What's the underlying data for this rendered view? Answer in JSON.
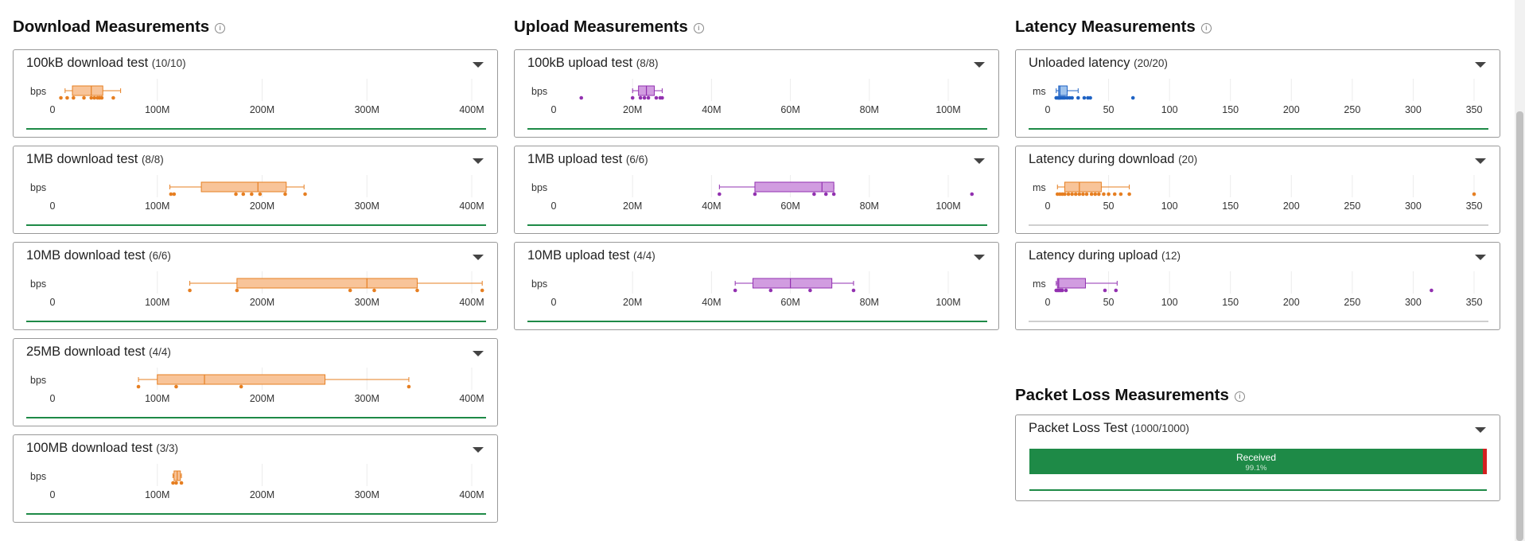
{
  "colors": {
    "download_fill": "#f8c499",
    "download_stroke": "#e67f22",
    "upload_fill": "#d19ce0",
    "upload_stroke": "#9231b0",
    "latency_unloaded_fill": "#9ec2ec",
    "latency_unloaded_stroke": "#1f63c4",
    "good_line": "#1e8a47",
    "neutral_line": "#cfcfcf",
    "packet_received": "#1e8a47",
    "packet_lost": "#d42020"
  },
  "sections": {
    "download": {
      "title": "Download Measurements",
      "info_icon": "info-icon",
      "cards": [
        {
          "title": "100kB download test",
          "count": "(10/10)",
          "unit": "bps",
          "axis_ticks": [
            "0",
            "100M",
            "200M",
            "300M",
            "400M"
          ],
          "box": {
            "min": 12000000,
            "q1": 19000000,
            "median": 37000000,
            "q3": 48000000,
            "max": 65000000
          },
          "points": [
            8000000,
            14000000,
            20000000,
            30000000,
            37000000,
            40000000,
            43000000,
            45000000,
            47000000,
            58000000
          ]
        },
        {
          "title": "1MB download test",
          "count": "(8/8)",
          "unit": "bps",
          "axis_ticks": [
            "0",
            "100M",
            "200M",
            "300M",
            "400M"
          ],
          "box": {
            "min": 112000000,
            "q1": 142000000,
            "median": 196000000,
            "q3": 223000000,
            "max": 240000000
          },
          "points": [
            113000000,
            116000000,
            175000000,
            182000000,
            190000000,
            198000000,
            222000000,
            241000000
          ]
        },
        {
          "title": "10MB download test",
          "count": "(6/6)",
          "unit": "bps",
          "axis_ticks": [
            "0",
            "100M",
            "200M",
            "300M",
            "400M"
          ],
          "box": {
            "min": 131000000,
            "q1": 176000000,
            "median": 300000000,
            "q3": 348000000,
            "max": 410000000
          },
          "points": [
            131000000,
            176000000,
            284000000,
            307000000,
            348000000,
            410000000
          ]
        },
        {
          "title": "25MB download test",
          "count": "(4/4)",
          "unit": "bps",
          "axis_ticks": [
            "0",
            "100M",
            "200M",
            "300M",
            "400M"
          ],
          "box": {
            "min": 82000000,
            "q1": 100000000,
            "median": 145000000,
            "q3": 260000000,
            "max": 340000000
          },
          "points": [
            82000000,
            118000000,
            180000000,
            340000000
          ]
        },
        {
          "title": "100MB download test",
          "count": "(3/3)",
          "unit": "bps",
          "axis_ticks": [
            "0",
            "100M",
            "200M",
            "300M",
            "400M"
          ],
          "box": {
            "min": 115000000,
            "q1": 116000000,
            "median": 119000000,
            "q3": 122000000,
            "max": 123000000
          },
          "points": [
            115000000,
            118000000,
            123000000
          ]
        }
      ]
    },
    "upload": {
      "title": "Upload Measurements",
      "info_icon": "info-icon",
      "cards": [
        {
          "title": "100kB upload test",
          "count": "(8/8)",
          "unit": "bps",
          "axis_ticks": [
            "0",
            "20M",
            "40M",
            "60M",
            "80M",
            "100M"
          ],
          "box": {
            "min": 20000000,
            "q1": 21500000,
            "median": 23500000,
            "q3": 25500000,
            "max": 27500000
          },
          "points": [
            7000000,
            20000000,
            22000000,
            23000000,
            24000000,
            26000000,
            27000000,
            27500000
          ]
        },
        {
          "title": "1MB upload test",
          "count": "(6/6)",
          "unit": "bps",
          "axis_ticks": [
            "0",
            "20M",
            "40M",
            "60M",
            "80M",
            "100M"
          ],
          "box": {
            "min": 42000000,
            "q1": 51000000,
            "median": 68000000,
            "q3": 71000000,
            "max": 71000000
          },
          "points": [
            42000000,
            51000000,
            66000000,
            69000000,
            71000000,
            106000000
          ]
        },
        {
          "title": "10MB upload test",
          "count": "(4/4)",
          "unit": "bps",
          "axis_ticks": [
            "0",
            "20M",
            "40M",
            "60M",
            "80M",
            "100M"
          ],
          "box": {
            "min": 46000000,
            "q1": 50500000,
            "median": 60000000,
            "q3": 70500000,
            "max": 76000000
          },
          "points": [
            46000000,
            55000000,
            65000000,
            76000000
          ]
        }
      ]
    },
    "latency": {
      "title": "Latency Measurements",
      "info_icon": "info-icon",
      "cards": [
        {
          "title": "Unloaded latency",
          "count": "(20/20)",
          "unit": "ms",
          "style": "unloaded",
          "axis_ticks": [
            "0",
            "50",
            "100",
            "150",
            "200",
            "250",
            "300",
            "350"
          ],
          "box": {
            "min": 7,
            "q1": 9,
            "median": 10,
            "q3": 16,
            "max": 25
          },
          "points": [
            7,
            8,
            9,
            9,
            10,
            10,
            11,
            12,
            13,
            14,
            16,
            18,
            20,
            25,
            30,
            33,
            35,
            70
          ]
        },
        {
          "title": "Latency during download",
          "count": "(20)",
          "unit": "ms",
          "style": "download",
          "axis_ticks": [
            "0",
            "50",
            "100",
            "150",
            "200",
            "250",
            "300",
            "350"
          ],
          "box": {
            "min": 8,
            "q1": 14,
            "median": 26,
            "q3": 44,
            "max": 67
          },
          "points": [
            8,
            10,
            12,
            14,
            17,
            20,
            23,
            26,
            29,
            32,
            36,
            39,
            42,
            46,
            50,
            55,
            60,
            67,
            350
          ]
        },
        {
          "title": "Latency during upload",
          "count": "(12)",
          "unit": "ms",
          "style": "upload",
          "axis_ticks": [
            "0",
            "50",
            "100",
            "150",
            "200",
            "250",
            "300",
            "350"
          ],
          "box": {
            "min": 7,
            "q1": 8,
            "median": 9,
            "q3": 31,
            "max": 57
          },
          "points": [
            7,
            8,
            9,
            10,
            11,
            12,
            15,
            47,
            56,
            315
          ]
        }
      ]
    },
    "packet_loss": {
      "title": "Packet Loss Measurements",
      "info_icon": "info-icon",
      "card": {
        "title": "Packet Loss Test",
        "count": "(1000/1000)",
        "received_label": "Received",
        "received_percent_label": "99.1%",
        "received_fraction": 0.991
      }
    }
  }
}
